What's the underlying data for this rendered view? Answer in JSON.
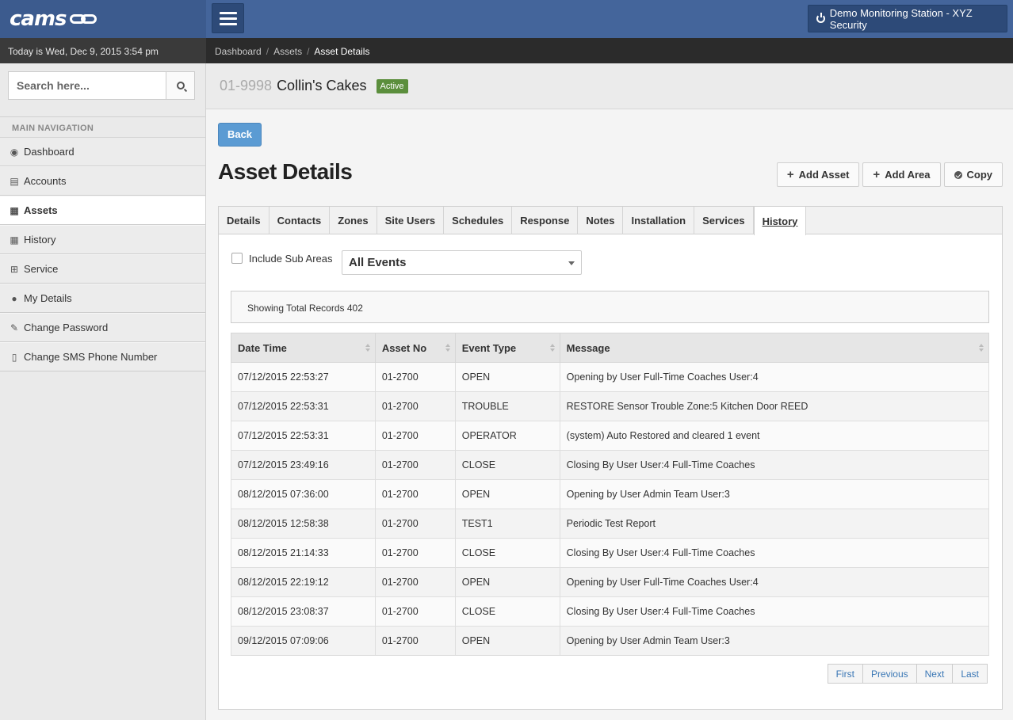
{
  "app": {
    "logo_text": "cams",
    "station_label": "Demo Monitoring Station - XYZ Security"
  },
  "date_text": "Today is Wed, Dec 9, 2015 3:54 pm",
  "breadcrumb": {
    "items": [
      "Dashboard",
      "Assets",
      "Asset Details"
    ],
    "separator": "/"
  },
  "sidebar": {
    "search_placeholder": "Search here...",
    "nav_header": "MAIN NAVIGATION",
    "items": [
      {
        "label": "Dashboard",
        "icon": "dashboard-icon"
      },
      {
        "label": "Accounts",
        "icon": "book-icon"
      },
      {
        "label": "Assets",
        "icon": "building-icon",
        "active": true
      },
      {
        "label": "History",
        "icon": "calendar-icon"
      },
      {
        "label": "Service",
        "icon": "medkit-icon"
      },
      {
        "label": "My Details",
        "icon": "user-icon"
      },
      {
        "label": "Change Password",
        "icon": "edit-icon"
      },
      {
        "label": "Change SMS Phone Number",
        "icon": "mobile-icon"
      }
    ]
  },
  "asset": {
    "number": "01-9998",
    "name": "Collin's Cakes",
    "status": "Active"
  },
  "main": {
    "back_label": "Back",
    "heading": "Asset Details",
    "actions": {
      "add_asset": "Add Asset",
      "add_area": "Add Area",
      "copy": "Copy"
    },
    "tabs": [
      "Details",
      "Contacts",
      "Zones",
      "Site Users",
      "Schedules",
      "Response",
      "Notes",
      "Installation",
      "Services",
      "History"
    ],
    "active_tab": "History",
    "filter": {
      "include_sub_areas": "Include Sub Areas",
      "event_select": "All Events"
    },
    "records_text": "Showing Total Records 402",
    "table": {
      "columns": [
        "Date Time",
        "Asset No",
        "Event Type",
        "Message"
      ],
      "rows": [
        [
          "07/12/2015 22:53:27",
          "01-2700",
          "OPEN",
          "Opening by User Full-Time Coaches User:4"
        ],
        [
          "07/12/2015 22:53:31",
          "01-2700",
          "TROUBLE",
          "RESTORE Sensor Trouble Zone:5 Kitchen Door REED"
        ],
        [
          "07/12/2015 22:53:31",
          "01-2700",
          "OPERATOR",
          "(system) Auto Restored and cleared 1 event"
        ],
        [
          "07/12/2015 23:49:16",
          "01-2700",
          "CLOSE",
          "Closing By User User:4 Full-Time Coaches"
        ],
        [
          "08/12/2015 07:36:00",
          "01-2700",
          "OPEN",
          "Opening by User Admin Team User:3"
        ],
        [
          "08/12/2015 12:58:38",
          "01-2700",
          "TEST1",
          "Periodic Test Report"
        ],
        [
          "08/12/2015 21:14:33",
          "01-2700",
          "CLOSE",
          "Closing By User User:4 Full-Time Coaches"
        ],
        [
          "08/12/2015 22:19:12",
          "01-2700",
          "OPEN",
          "Opening by User Full-Time Coaches User:4"
        ],
        [
          "08/12/2015 23:08:37",
          "01-2700",
          "CLOSE",
          "Closing By User User:4 Full-Time Coaches"
        ],
        [
          "09/12/2015 07:09:06",
          "01-2700",
          "OPEN",
          "Opening by User Admin Team User:3"
        ]
      ]
    },
    "pager": [
      "First",
      "Previous",
      "Next",
      "Last"
    ]
  },
  "colors": {
    "topbar": "#44659b",
    "active_badge": "#5b8e3c",
    "back_button": "#5b9bd3",
    "link": "#3a77b5"
  }
}
